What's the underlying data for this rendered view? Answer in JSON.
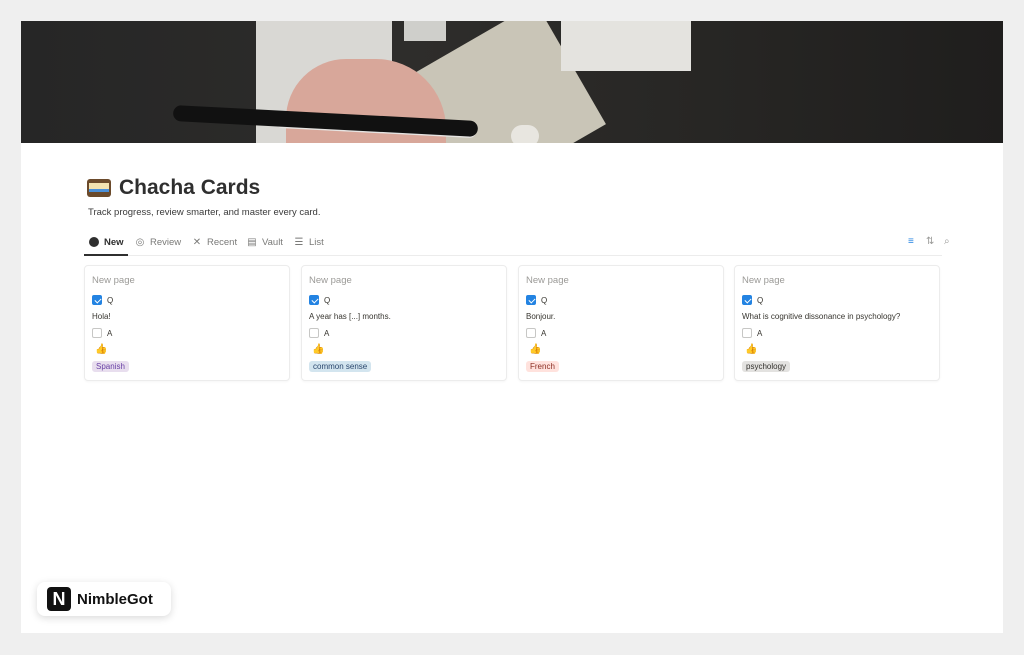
{
  "page": {
    "title": "Chacha Cards",
    "subtitle": "Track progress, review smarter, and master every card."
  },
  "tabs": [
    {
      "label": "New"
    },
    {
      "label": "Review"
    },
    {
      "label": "Recent"
    },
    {
      "label": "Vault"
    },
    {
      "label": "List"
    }
  ],
  "cards": [
    {
      "title": "New page",
      "q_label": "Q",
      "q_checked": true,
      "question": "Hola!",
      "a_label": "A",
      "a_checked": false,
      "tag": "Spanish",
      "tag_bg": "#e8deee",
      "tag_color": "#6940a5"
    },
    {
      "title": "New page",
      "q_label": "Q",
      "q_checked": true,
      "question": "A year has [...] months.",
      "a_label": "A",
      "a_checked": false,
      "tag": "common sense",
      "tag_bg": "#d3e5ef",
      "tag_color": "#28456c"
    },
    {
      "title": "New page",
      "q_label": "Q",
      "q_checked": true,
      "question": "Bonjour.",
      "a_label": "A",
      "a_checked": false,
      "tag": "French",
      "tag_bg": "#ffe2dd",
      "tag_color": "#8c2f24"
    },
    {
      "title": "New page",
      "q_label": "Q",
      "q_checked": true,
      "question": "What is cognitive dissonance in psychology?",
      "a_label": "A",
      "a_checked": false,
      "tag": "psychology",
      "tag_bg": "#e3e2e0",
      "tag_color": "#32302c"
    }
  ],
  "badge": {
    "logo_letter": "N",
    "text": "NimbleGot"
  },
  "colors": {
    "accent": "#2383e2",
    "filter_icon": "#2383e2"
  }
}
